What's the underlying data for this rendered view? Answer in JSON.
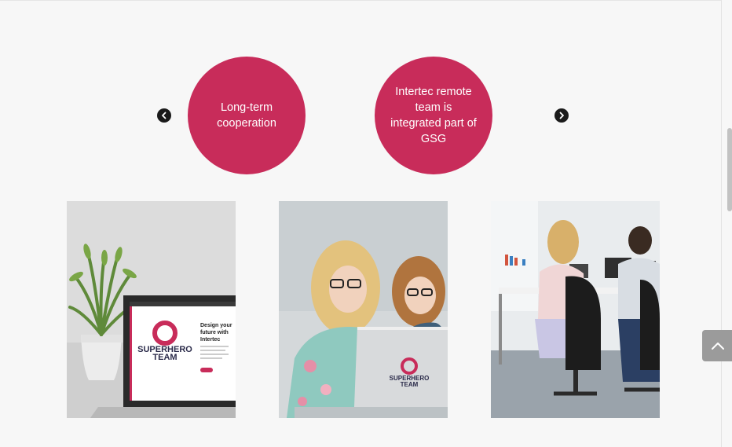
{
  "carousel": {
    "slides": [
      {
        "text": "Long-term cooperation"
      },
      {
        "text": "Intertec remote team is integrated part of GSG"
      }
    ],
    "prev_icon": "chevron-left-circle",
    "next_icon": "chevron-right-circle"
  },
  "gallery": {
    "photos": [
      {
        "subject": "laptop-with-plant",
        "screen_logo": {
          "line1": "SUPERHERO",
          "line2": "TEAM"
        },
        "screen_heading": [
          "Design your",
          "future with",
          "Intertec"
        ]
      },
      {
        "subject": "two-women-at-laptop",
        "laptop_logo": {
          "line1": "SUPERHERO",
          "line2": "TEAM"
        }
      },
      {
        "subject": "office-workers-at-desks"
      }
    ]
  },
  "back_to_top": {
    "icon": "chevron-up-icon"
  },
  "colors": {
    "accent": "#c82c5a",
    "background": "#f7f7f7",
    "arrow": "#1a1a1a",
    "back_to_top": "#9b9b9b"
  }
}
